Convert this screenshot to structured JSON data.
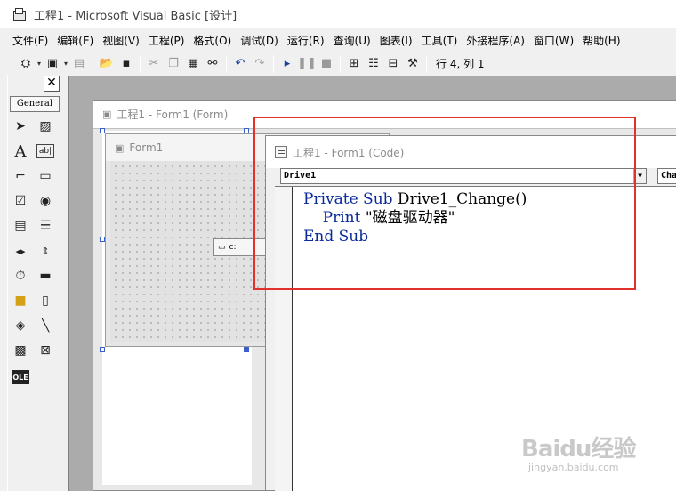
{
  "window": {
    "title": "工程1 - Microsoft Visual Basic [设计]"
  },
  "menu": [
    "文件(F)",
    "编辑(E)",
    "视图(V)",
    "工程(P)",
    "格式(O)",
    "调试(D)",
    "运行(R)",
    "查询(U)",
    "图表(I)",
    "工具(T)",
    "外接程序(A)",
    "窗口(W)",
    "帮助(H)"
  ],
  "toolbar": {
    "cursor_position": "行 4, 列 1"
  },
  "toolbox": {
    "tab_label": "General",
    "close_glyph": "✕"
  },
  "designer": {
    "title": "工程1 - Form1 (Form)"
  },
  "form": {
    "title": "Form1",
    "drive_value": "c:"
  },
  "code": {
    "title": "工程1 - Form1 (Code)",
    "object": "Drive1",
    "procedure": "Change",
    "lines": [
      "Private Sub Drive1_Change()",
      "    Print \"磁盘驱动器\"",
      "End Sub"
    ]
  },
  "watermark": {
    "logo": "Baidu经验",
    "url": "jingyan.baidu.com"
  },
  "colors": {
    "highlight": "#e0322a",
    "keyword": "#0a2a9a",
    "workspace": "#ababab",
    "selection_handle": "#3a5fcd"
  },
  "icons": [
    "app-icon",
    "add-project-icon",
    "add-form-icon",
    "menu-editor-icon",
    "open-icon",
    "save-icon",
    "cut-icon",
    "copy-icon",
    "paste-icon",
    "find-icon",
    "undo-icon",
    "redo-icon",
    "start-icon",
    "break-icon",
    "end-icon",
    "project-explorer-icon",
    "properties-icon",
    "form-layout-icon",
    "toolbox-icon"
  ]
}
